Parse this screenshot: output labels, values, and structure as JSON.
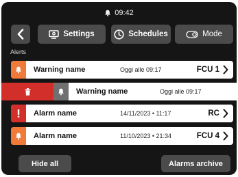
{
  "status": {
    "time": "09:42"
  },
  "toolbar": {
    "settings_label": "Settings",
    "schedules_label": "Schedules",
    "mode_label": "Mode"
  },
  "section_label": "Alerts",
  "alerts": [
    {
      "name": "Warning name",
      "time": "Oggi alle 09:17",
      "source": "FCU 1",
      "type": "warning"
    },
    {
      "name": "Warning name",
      "time": "Oggi alle 09:17",
      "source": "",
      "type": "warning-read"
    },
    {
      "name": "Alarm name",
      "time": "14/11/2023 • 11:17",
      "source": "RC",
      "type": "alarm"
    },
    {
      "name": "Alarm name",
      "time": "11/10/2023 • 21:34",
      "source": "FCU 4",
      "type": "warning"
    }
  ],
  "footer": {
    "hide_all_label": "Hide all",
    "archive_label": "Alarms archive"
  },
  "colors": {
    "warning": "#f07a3a",
    "alarm": "#d22f2b",
    "read": "#707070",
    "background": "#151515",
    "button": "#4b4b4b"
  },
  "icons": {
    "status": "bell-icon",
    "back": "chevron-left-icon",
    "settings": "monitor-icon",
    "schedules": "clock-icon",
    "mode": "toggle-icon",
    "warning": "bell-icon",
    "alarm": "exclamation-icon",
    "delete": "trash-icon",
    "row_action": "chevron-right-icon"
  }
}
